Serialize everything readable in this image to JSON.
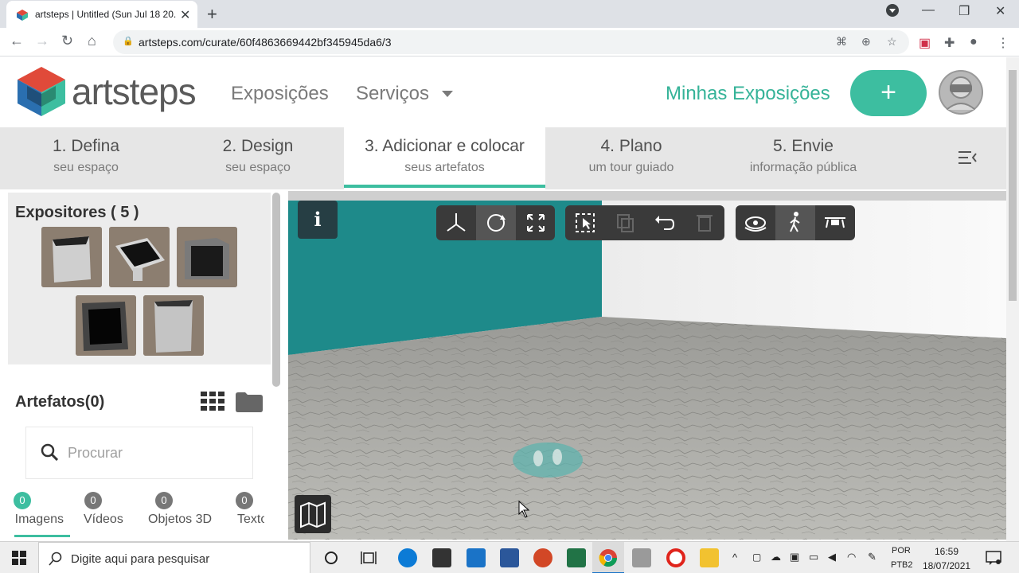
{
  "browser": {
    "tab_title": "artsteps | Untitled (Sun Jul 18 20...",
    "url": "artsteps.com/curate/60f4863669442bf345945da6/3"
  },
  "header": {
    "logo_text": "artsteps",
    "nav": [
      "Exposições",
      "Serviços"
    ],
    "my_exhibitions": "Minhas Exposições",
    "add_label": "+"
  },
  "steps": [
    {
      "title": "1. Defina",
      "sub": "seu espaço"
    },
    {
      "title": "2. Design",
      "sub": "seu espaço"
    },
    {
      "title": "3. Adicionar e colocar",
      "sub": "seus artefatos"
    },
    {
      "title": "4. Plano",
      "sub": "um tour guiado"
    },
    {
      "title": "5. Envie",
      "sub": "informação pública"
    }
  ],
  "panel": {
    "displays_title": "Expositores ( 5 )",
    "artifacts_title": "Artefatos(0)",
    "search_placeholder": "Procurar",
    "categories": [
      {
        "label": "Imagens",
        "count": "0"
      },
      {
        "label": "Vídeos",
        "count": "0"
      },
      {
        "label": "Objetos 3D",
        "count": "0"
      },
      {
        "label": "Textos",
        "count": "0"
      }
    ]
  },
  "viewport": {
    "info_label": "i"
  },
  "taskbar": {
    "search_placeholder": "Digite aqui para pesquisar",
    "lang_top": "POR",
    "lang_bottom": "PTB2",
    "time": "16:59",
    "date": "18/07/2021"
  },
  "colors": {
    "accent": "#3dbea0",
    "wall_teal": "#1e8a8a",
    "toolbar_dark": "#3a3a3a"
  }
}
